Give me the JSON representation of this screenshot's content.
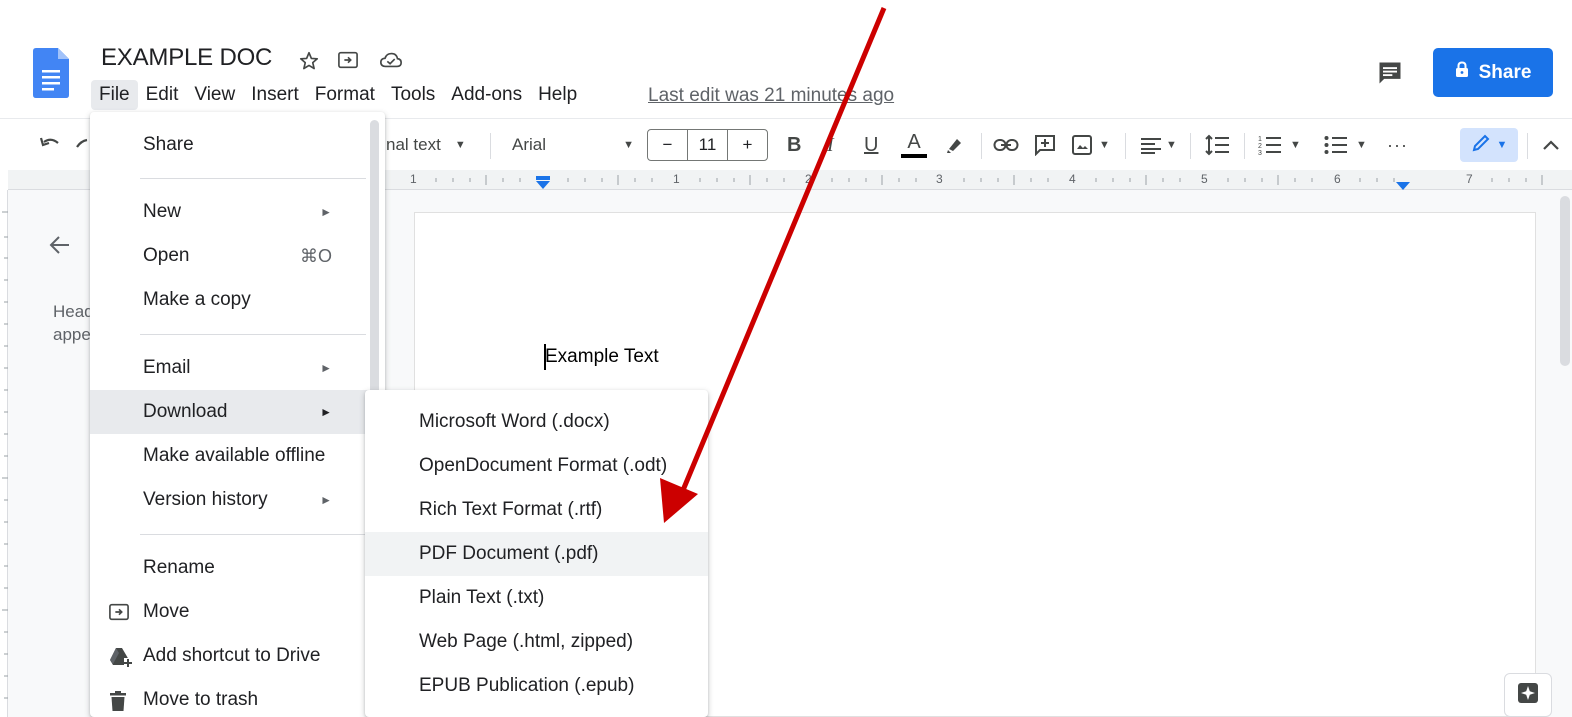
{
  "header": {
    "doc_title": "EXAMPLE DOC",
    "last_edit": "Last edit was 21 minutes ago",
    "share_label": "Share",
    "icons": [
      "docs-logo-icon",
      "star-icon",
      "move-folder-icon",
      "cloud-status-icon",
      "comment-icon",
      "lock-icon"
    ]
  },
  "menubar": {
    "items": [
      "File",
      "Edit",
      "View",
      "Insert",
      "Format",
      "Tools",
      "Add-ons",
      "Help"
    ]
  },
  "toolbar": {
    "style_value": "Normal text",
    "style_visible": "nal text",
    "font_value": "Arial",
    "font_size": "11",
    "minus": "−",
    "plus": "+"
  },
  "ruler": {
    "numbers": [
      "1",
      "1",
      "2",
      "3",
      "4",
      "5",
      "6",
      "7"
    ]
  },
  "outline": {
    "text_line1": "Headings you add to the document will",
    "text_line2": "appear here."
  },
  "document": {
    "body_text": "Example Text"
  },
  "file_menu": {
    "items": [
      {
        "label": "Share"
      },
      {
        "label": "New",
        "submenu": true
      },
      {
        "label": "Open",
        "shortcut": "⌘O"
      },
      {
        "label": "Make a copy"
      },
      {
        "label": "Email",
        "submenu": true
      },
      {
        "label": "Download",
        "submenu": true,
        "highlighted": true
      },
      {
        "label": "Make available offline"
      },
      {
        "label": "Version history",
        "submenu": true
      },
      {
        "label": "Rename"
      },
      {
        "label": "Move",
        "icon": "move-folder-icon"
      },
      {
        "label": "Add shortcut to Drive",
        "icon": "drive-add-icon"
      },
      {
        "label": "Move to trash",
        "icon": "trash-icon"
      }
    ],
    "submenu_arrow": "►"
  },
  "download_menu": {
    "items": [
      {
        "label": "Microsoft Word (.docx)"
      },
      {
        "label": "OpenDocument Format (.odt)"
      },
      {
        "label": "Rich Text Format (.rtf)"
      },
      {
        "label": "PDF Document (.pdf)",
        "highlighted": true
      },
      {
        "label": "Plain Text (.txt)"
      },
      {
        "label": "Web Page (.html, zipped)"
      },
      {
        "label": "EPUB Publication (.epub)"
      }
    ]
  },
  "colors": {
    "accent": "#1a73e8",
    "annotation_arrow": "#cc0000",
    "menu_highlight": "#e8eaed"
  }
}
